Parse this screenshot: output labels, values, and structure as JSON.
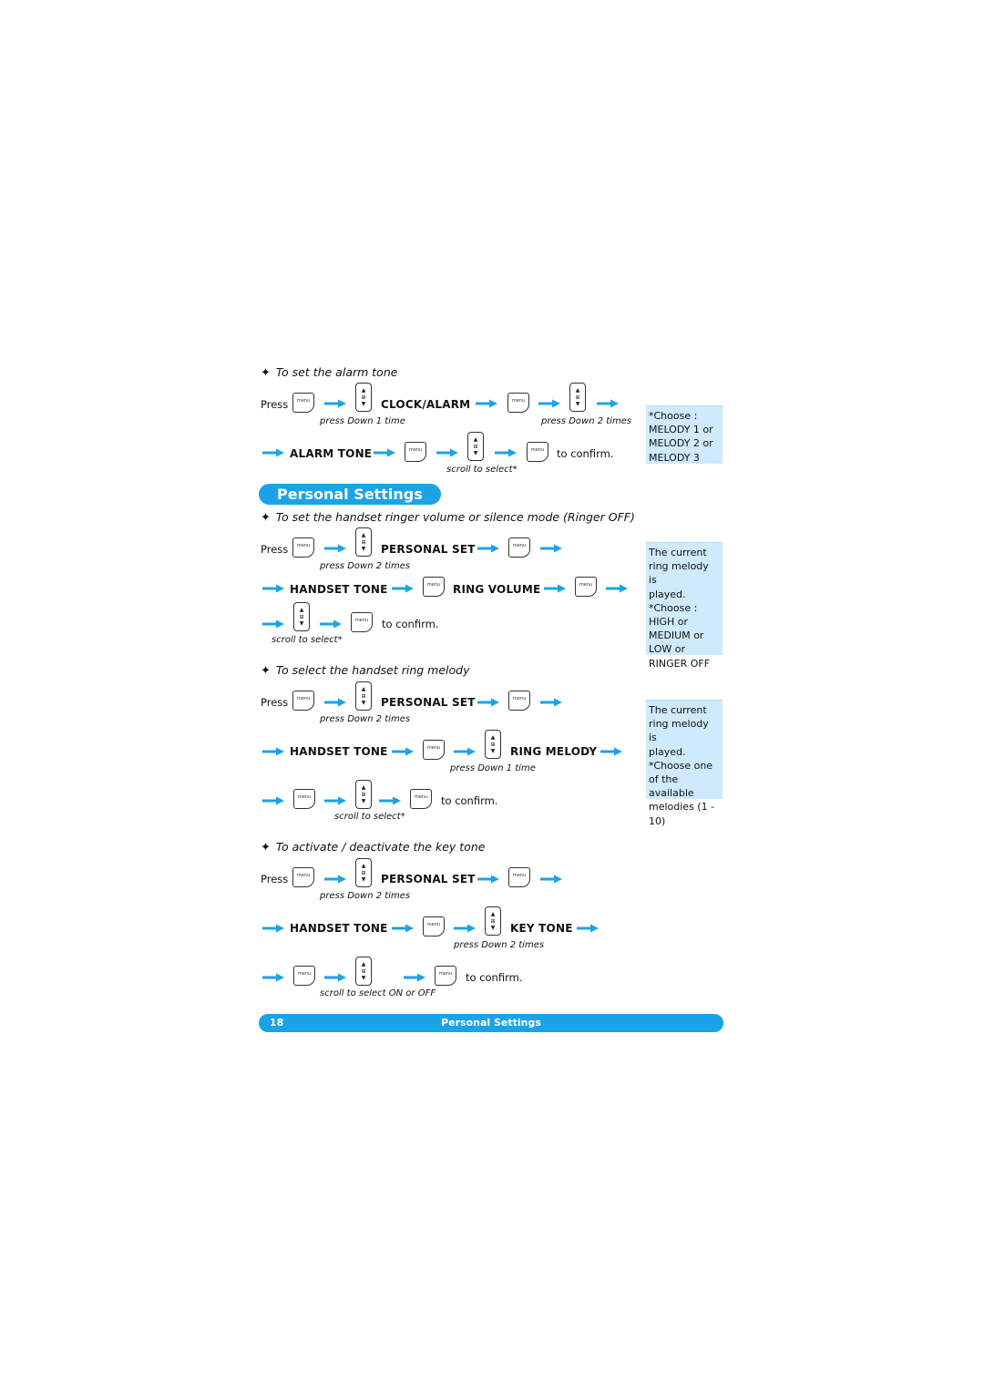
{
  "page_title": "Personal Settings",
  "footer": {
    "page_number": "18",
    "section": "Personal Settings"
  },
  "colors": {
    "accent": "#1ba3e8",
    "sidebox_bg": "#cfeafb"
  },
  "keys": {
    "menu_label": "menu",
    "nav_up": "▲",
    "nav_mid": "⊞",
    "nav_down": "▼"
  },
  "common": {
    "press": "Press",
    "to_confirm": "to confirm."
  },
  "alarm": {
    "heading": "To set the alarm tone",
    "step_clock_alarm": "CLOCK/ALARM",
    "step_alarm_tone": "ALARM TONE",
    "note_down_1": "press Down 1 time",
    "note_down_2": "press Down 2 times",
    "note_scroll": "scroll to select*",
    "sidebox": [
      "*Choose :",
      "MELODY 1 or",
      "MELODY 2 or",
      "MELODY 3"
    ]
  },
  "ringer_volume": {
    "heading": "To set the handset ringer volume or silence mode (Ringer OFF)",
    "step_personal_set": "PERSONAL SET",
    "step_handset_tone": "HANDSET TONE",
    "step_ring_volume": "RING VOLUME",
    "note_down_2": "press Down 2 times",
    "note_scroll": "scroll to select*",
    "sidebox": [
      "The current",
      "ring melody is",
      "played.",
      "*Choose :",
      "HIGH or",
      "MEDIUM or",
      "LOW or",
      "RINGER OFF"
    ]
  },
  "ring_melody": {
    "heading": "To select the handset ring melody",
    "step_personal_set": "PERSONAL SET",
    "step_handset_tone": "HANDSET TONE",
    "step_ring_melody": "RING MELODY",
    "note_down_2": "press Down 2 times",
    "note_down_1": "press Down 1 time",
    "note_scroll": "scroll to select*",
    "sidebox": [
      "The current",
      "ring melody is",
      "played.",
      "*Choose one",
      "of the available",
      "melodies (1 -",
      "10)"
    ]
  },
  "key_tone": {
    "heading": "To activate / deactivate the key tone",
    "step_personal_set": "PERSONAL SET",
    "step_handset_tone": "HANDSET TONE",
    "step_key_tone": "KEY TONE",
    "note_down_2a": "press Down 2 times",
    "note_down_2b": "press Down 2 times",
    "note_scroll": "scroll to select ON or OFF"
  }
}
